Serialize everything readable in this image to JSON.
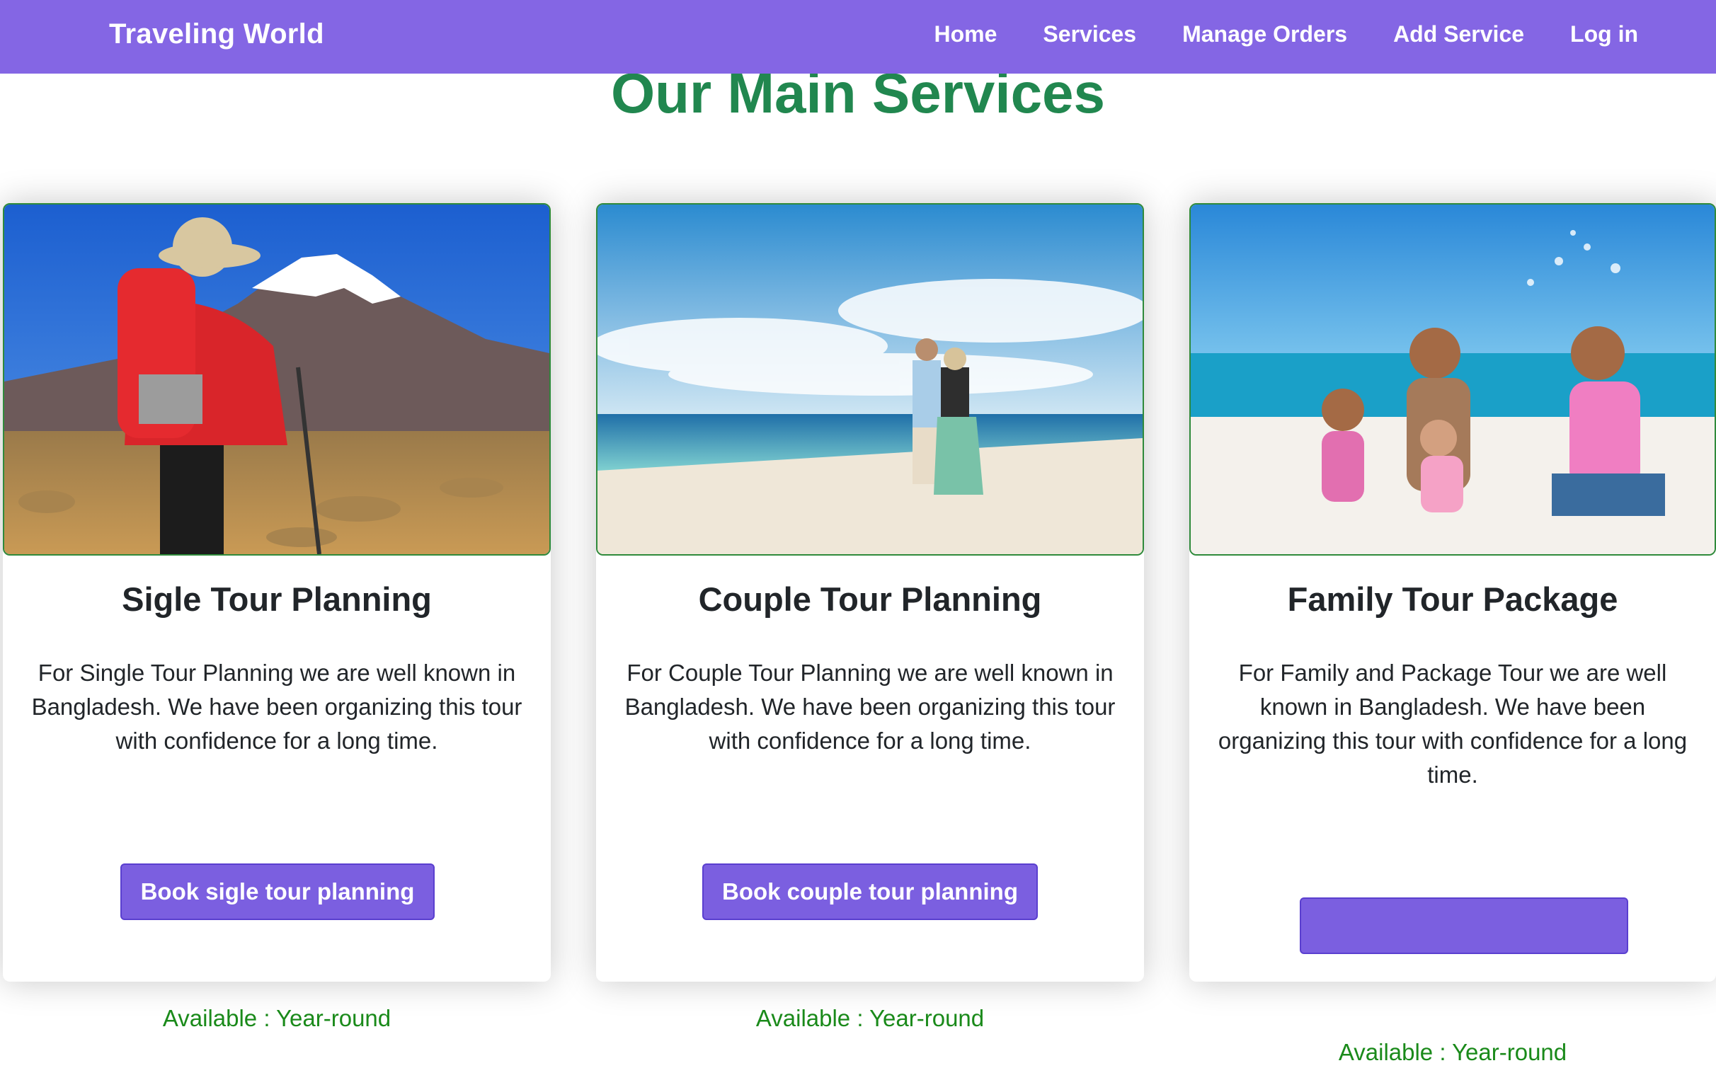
{
  "navbar": {
    "brand": "Traveling World",
    "links": [
      "Home",
      "Services",
      "Manage Orders",
      "Add Service",
      "Log in"
    ]
  },
  "page_title": "Our Main Services",
  "services": [
    {
      "title": "Sigle Tour Planning",
      "description": "For Single Tour Planning we are well known in Bangladesh. We have been organizing this tour with confidence for a long time.",
      "availability": "Available : Year-round",
      "button": "Book sigle tour planning"
    },
    {
      "title": "Couple Tour Planning",
      "description": "For Couple Tour Planning we are well known in Bangladesh. We have been organizing this tour with confidence for a long time.",
      "availability": "Available : Year-round",
      "button": "Book couple tour planning"
    },
    {
      "title": "Family Tour Package",
      "description": "For Family and Package Tour we are well known in Bangladesh. We have been organizing this tour with confidence for a long time.",
      "availability": "Available : Year-round",
      "button": ""
    }
  ],
  "colors": {
    "navbar": "#8466e4",
    "title_green": "#21874f",
    "available_green": "#1a8a1a",
    "button": "#7b5fe0"
  }
}
